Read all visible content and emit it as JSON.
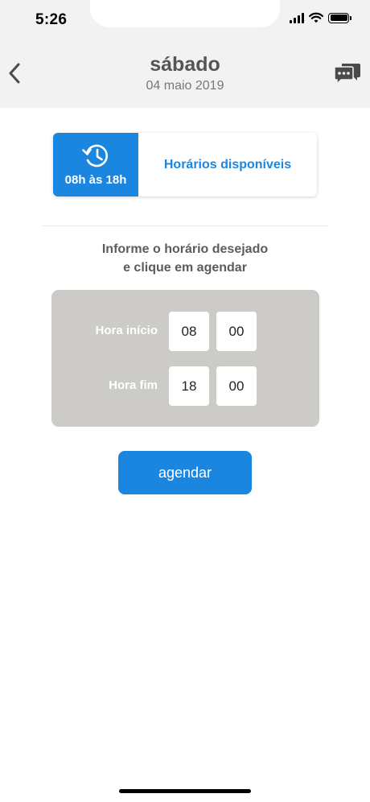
{
  "status_bar": {
    "time": "5:26"
  },
  "header": {
    "title": "sábado",
    "subtitle": "04 maio 2019"
  },
  "availability": {
    "hours": "08h às 18h",
    "label": "Horários disponíveis"
  },
  "instruction": {
    "line1": "Informe o horário desejado",
    "line2": "e clique em agendar"
  },
  "time_form": {
    "start_label": "Hora início",
    "start_hour": "08",
    "start_minute": "00",
    "end_label": "Hora fim",
    "end_hour": "18",
    "end_minute": "00"
  },
  "actions": {
    "schedule_label": "agendar"
  },
  "colors": {
    "accent": "#1b86e0",
    "header_bg": "#f2f2f2",
    "panel_bg": "#cccbc7",
    "title_text": "#555555"
  },
  "icons": {
    "back": "chevron-left-icon",
    "chat": "chat-bubbles-icon",
    "clock": "clock-history-icon",
    "signal": "signal-icon",
    "wifi": "wifi-icon",
    "battery": "battery-icon"
  }
}
